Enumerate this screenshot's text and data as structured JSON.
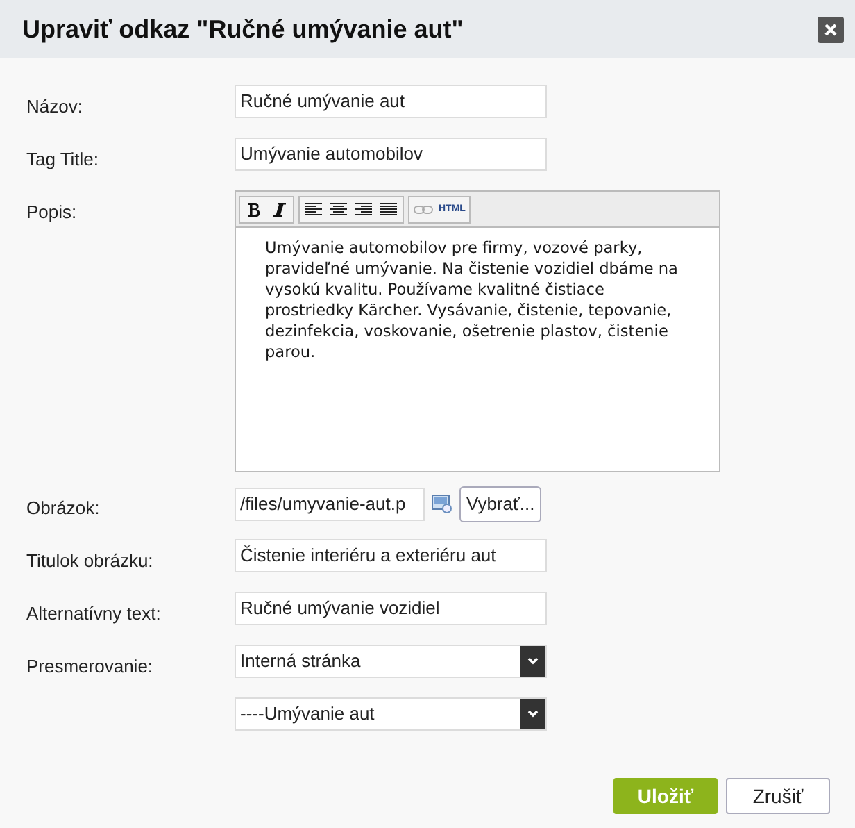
{
  "dialog": {
    "title": "Upraviť odkaz \"Ručné umývanie aut\""
  },
  "fields": [
    {
      "kind": "text",
      "label": "Názov:",
      "value": "Ručné umývanie aut"
    },
    {
      "kind": "text",
      "label": "Tag Title:",
      "value": "Umývanie automobilov"
    },
    {
      "kind": "editor",
      "label": "Popis:",
      "toolbar_html": "HTML",
      "value": "Umývanie automobilov pre firmy, vozové parky, pravideľné umývanie. Na čistenie vozidiel dbáme na vysokú kvalitu. Používame kvalitné čistiace prostriedky Kärcher. Vysávanie, čistenie, tepovanie, dezinfekcia, voskovanie, ošetrenie plastov, čistenie parou."
    },
    {
      "kind": "file",
      "label": "Obrázok:",
      "value": "/files/umyvanie-aut.p",
      "browse": "Vybrať..."
    },
    {
      "kind": "text",
      "label": "Titulok obrázku:",
      "value": "Čistenie interiéru a exteriéru aut"
    },
    {
      "kind": "text",
      "label": "Alternatívny text:",
      "value": "Ručné umývanie vozidiel"
    },
    {
      "kind": "select",
      "label": "Presmerovanie:",
      "value": "Interná stránka"
    },
    {
      "kind": "select",
      "value": "----Umývanie aut"
    }
  ],
  "buttons": {
    "save": "Uložiť",
    "cancel": "Zrušiť"
  }
}
